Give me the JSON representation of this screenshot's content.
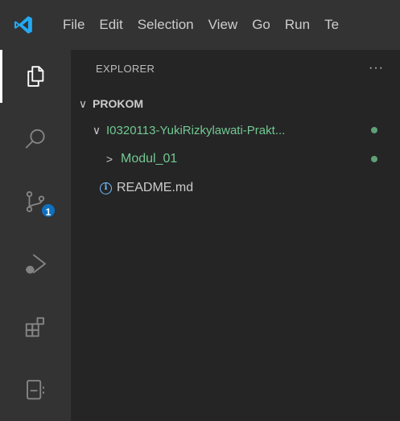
{
  "titlebar": {
    "menu": [
      {
        "id": "file",
        "label": "File"
      },
      {
        "id": "edit",
        "label": "Edit"
      },
      {
        "id": "selection",
        "label": "Selection"
      },
      {
        "id": "view",
        "label": "View"
      },
      {
        "id": "go",
        "label": "Go"
      },
      {
        "id": "run",
        "label": "Run"
      },
      {
        "id": "terminal",
        "label": "Te"
      }
    ]
  },
  "activitybar": {
    "items": [
      {
        "name": "explorer",
        "icon": "files-icon",
        "active": true
      },
      {
        "name": "search",
        "icon": "search-icon"
      },
      {
        "name": "source-control",
        "icon": "source-control-icon",
        "badge": "1"
      },
      {
        "name": "run-debug",
        "icon": "run-debug-icon"
      },
      {
        "name": "extensions",
        "icon": "extensions-icon"
      },
      {
        "name": "remote",
        "icon": "remote-explorer-icon"
      }
    ]
  },
  "sidebar": {
    "title": "EXPLORER",
    "more": "···",
    "root": {
      "label": "PROKOM",
      "chevron": "∨"
    },
    "items": [
      {
        "label": "I0320113-YukiRizkylawati-Prakt...",
        "chevron": "∨",
        "type": "folder",
        "modified": true
      },
      {
        "label": "Modul_01",
        "chevron": ">",
        "type": "folder",
        "modified": true
      },
      {
        "label": "README.md",
        "type": "file",
        "icon": "info-icon",
        "icon_glyph": "i"
      }
    ]
  },
  "colors": {
    "titlebar": "#333333",
    "activitybar": "#333333",
    "sidebar": "#252526",
    "git_modified": "#73c991",
    "badge": "#0e70c0",
    "logo": "#23a9f2"
  }
}
